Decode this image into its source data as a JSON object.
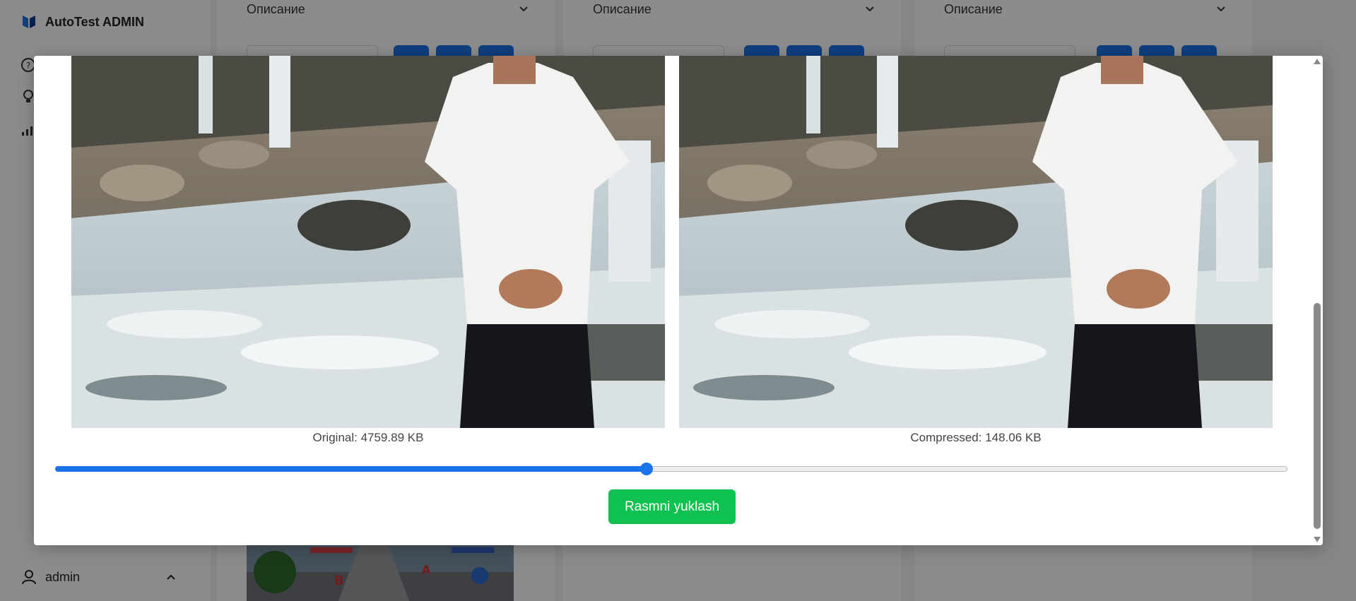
{
  "app": {
    "title": "AutoTest ADMIN",
    "brand_color": "#1a73e8"
  },
  "sidebar": {
    "icons": [
      "help-icon",
      "lightbulb-icon",
      "chart-icon"
    ],
    "user": {
      "name": "admin"
    }
  },
  "columns": [
    {
      "header": "Описание"
    },
    {
      "header": "Описание"
    },
    {
      "header": "Описание"
    }
  ],
  "modal": {
    "original_caption": "Original: 4759.89 KB",
    "compressed_caption": "Compressed: 148.06 KB",
    "quality_slider": {
      "value_percent": 48,
      "color": "#1a73e8"
    },
    "upload_button": {
      "label": "Rasmni yuklash",
      "color": "#0fc24f"
    }
  }
}
